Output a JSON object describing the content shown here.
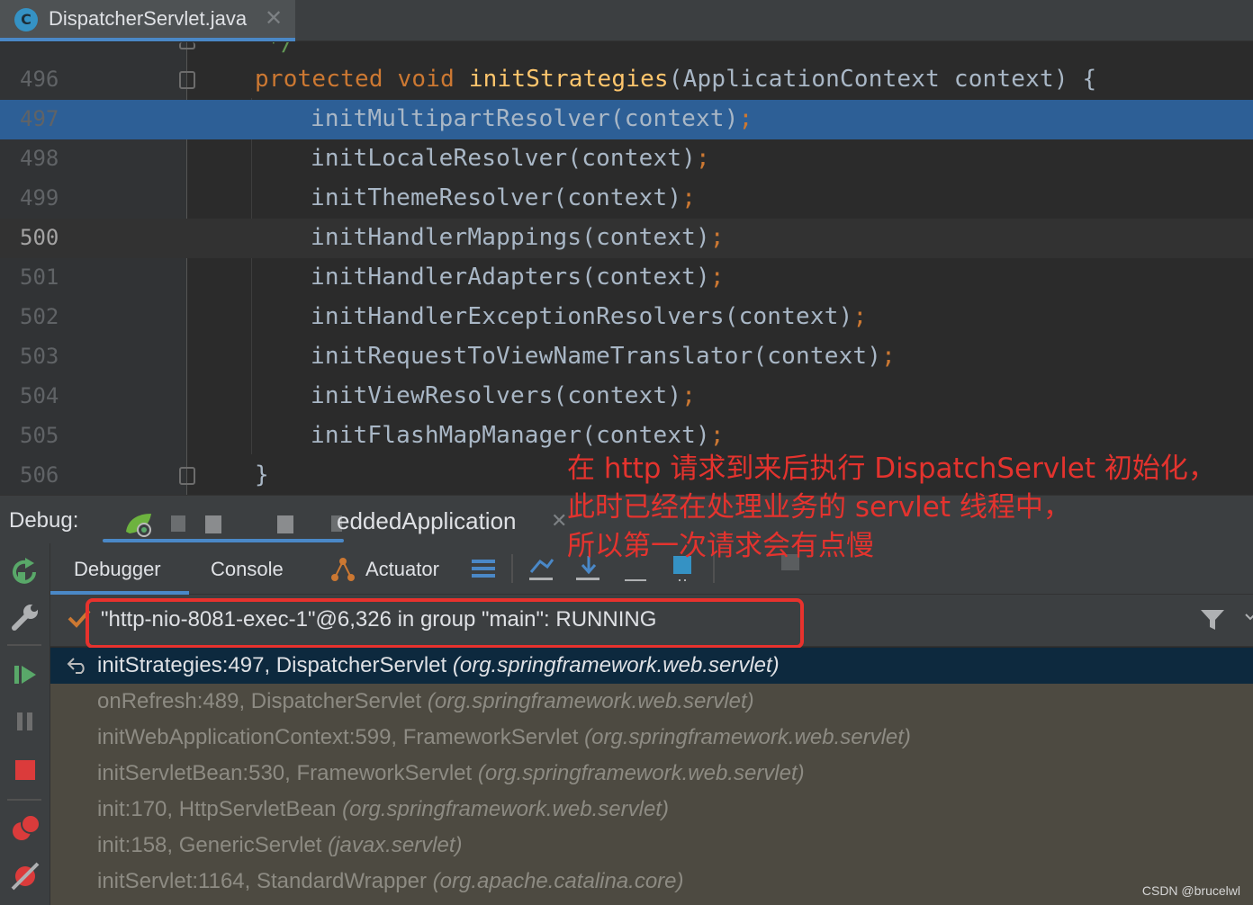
{
  "editor_tab": {
    "icon_letter": "C",
    "file_name": "DispatcherServlet.java"
  },
  "editor": {
    "current_line": "500",
    "highlighted_line": "497",
    "lines": [
      {
        "n": "496",
        "kw1": "protected",
        "kw2": "void",
        "fn": "initStrategies",
        "rest": "(ApplicationContext context) {"
      },
      {
        "n": "497",
        "call": "initMultipartResolver(context)",
        "semi": ";"
      },
      {
        "n": "498",
        "call": "initLocaleResolver(context)",
        "semi": ";"
      },
      {
        "n": "499",
        "call": "initThemeResolver(context)",
        "semi": ";"
      },
      {
        "n": "500",
        "call": "initHandlerMappings(context)",
        "semi": ";"
      },
      {
        "n": "501",
        "call": "initHandlerAdapters(context)",
        "semi": ";"
      },
      {
        "n": "502",
        "call": "initHandlerExceptionResolvers(context)",
        "semi": ";"
      },
      {
        "n": "503",
        "call": "initRequestToViewNameTranslator(context)",
        "semi": ";"
      },
      {
        "n": "504",
        "call": "initViewResolvers(context)",
        "semi": ";"
      },
      {
        "n": "505",
        "call": "initFlashMapManager(context)",
        "semi": ";"
      },
      {
        "n": "506",
        "brace": "}"
      }
    ]
  },
  "debug_panel": {
    "title": "Debug:",
    "run_config_visible": "eddedApplication",
    "run_config_icon": "spring-boot-debug-icon",
    "tabs": [
      "Debugger",
      "Console",
      "Actuator"
    ],
    "active_tab": "Debugger"
  },
  "thread": {
    "label": "\"http-nio-8081-exec-1\"@6,326 in group \"main\": RUNNING"
  },
  "frames": [
    {
      "method": "initStrategies:497, DispatcherServlet",
      "pkg": "(org.springframework.web.servlet)"
    },
    {
      "method": "onRefresh:489, DispatcherServlet",
      "pkg": "(org.springframework.web.servlet)"
    },
    {
      "method": "initWebApplicationContext:599, FrameworkServlet",
      "pkg": "(org.springframework.web.servlet)"
    },
    {
      "method": "initServletBean:530, FrameworkServlet",
      "pkg": "(org.springframework.web.servlet)"
    },
    {
      "method": "init:170, HttpServletBean",
      "pkg": "(org.springframework.web.servlet)"
    },
    {
      "method": "init:158, GenericServlet",
      "pkg": "(javax.servlet)"
    },
    {
      "method": "initServlet:1164, StandardWrapper",
      "pkg": "(org.apache.catalina.core)"
    }
  ],
  "annotation": {
    "line1": "在 http 请求到来后执行 DispatchServlet 初始化，",
    "line2": "此时已经在处理业务的 servlet 线程中，",
    "line3": "所以第一次请求会有点慢",
    "color": "#e4332e"
  },
  "watermark": "CSDN @brucelwl",
  "colors": {
    "keyword": "#cc7832",
    "method_decl": "#ffc66d",
    "selection": "#2d5f96",
    "accent": "#4a88c7",
    "resume_green": "#59a869",
    "stop_red": "#db3b3b"
  }
}
